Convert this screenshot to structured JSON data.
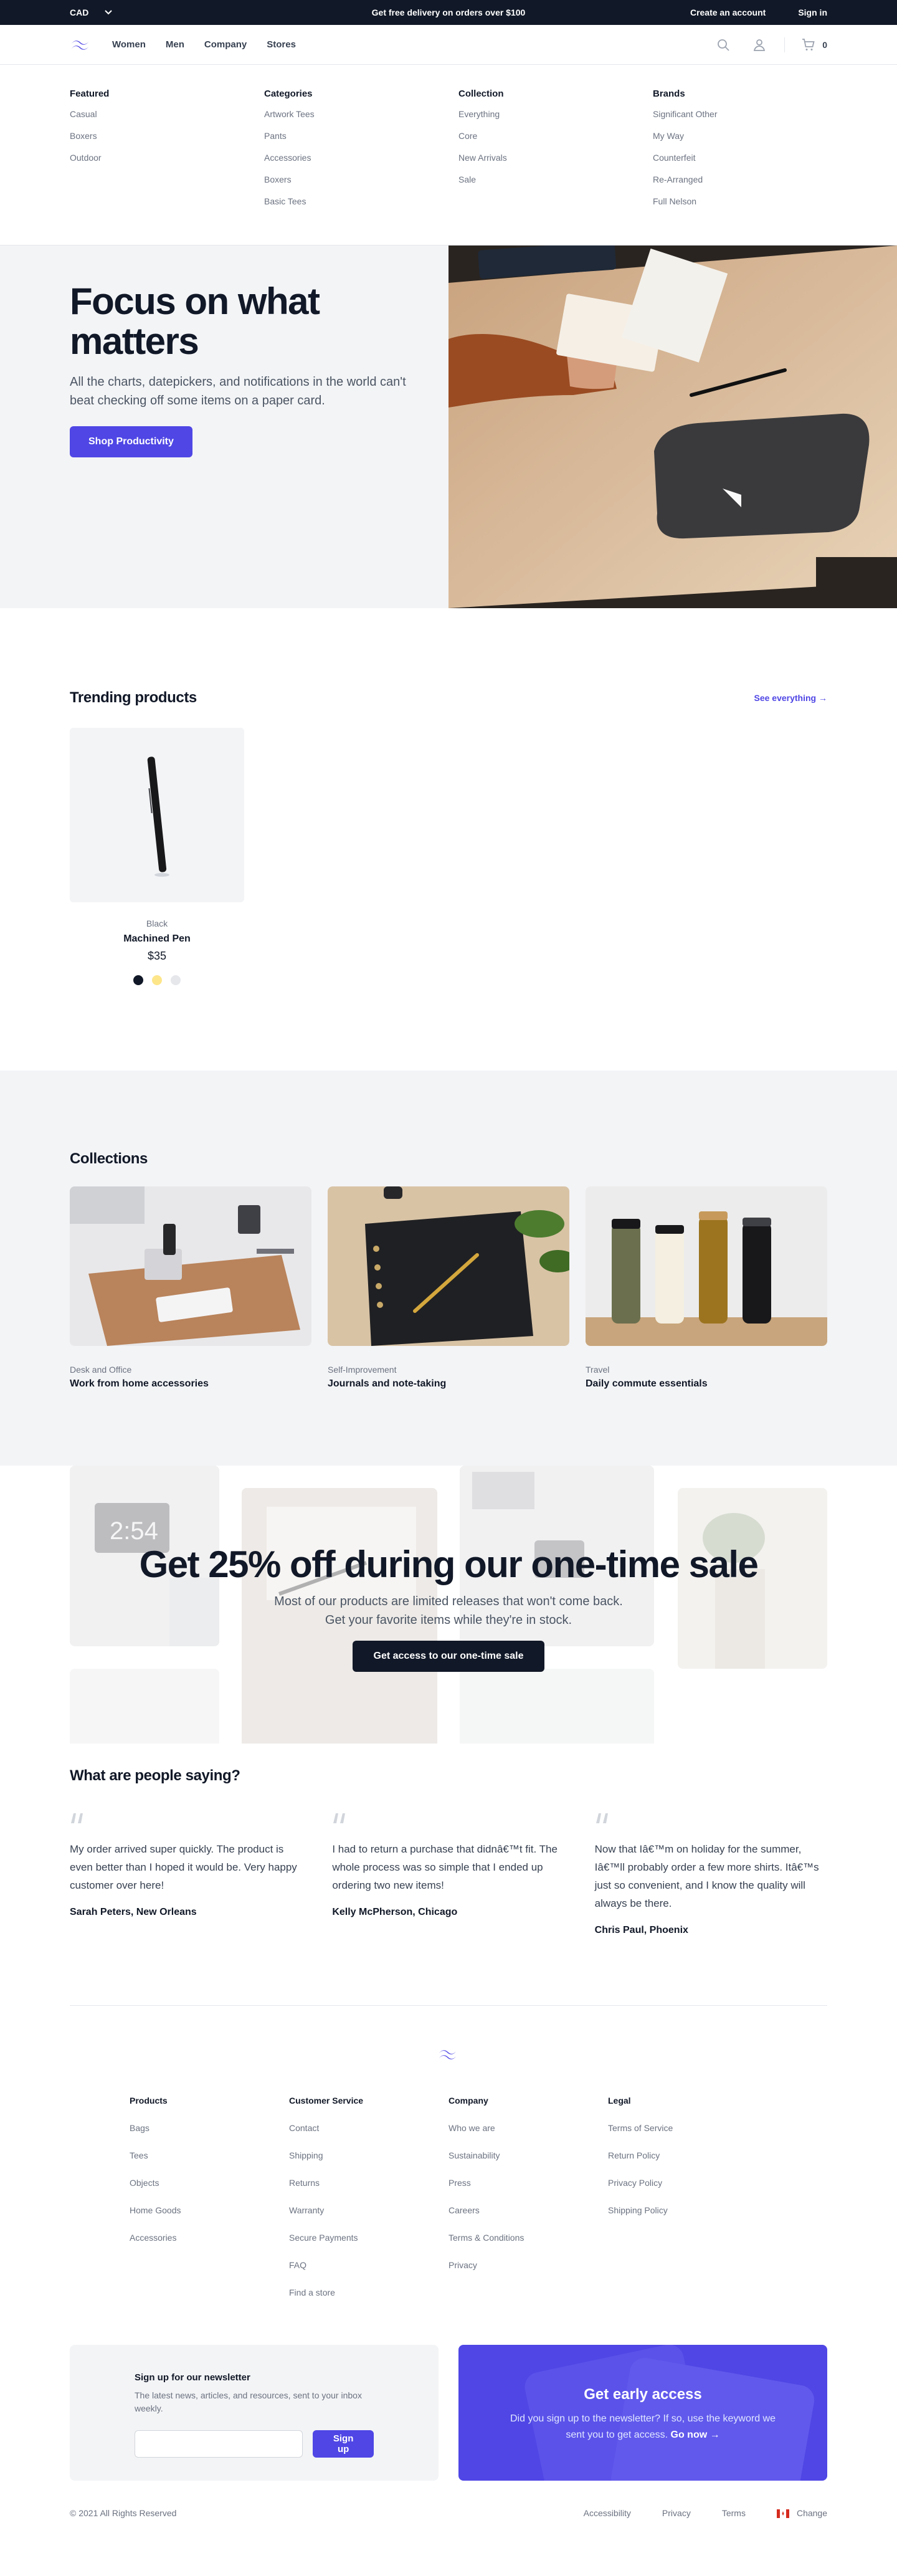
{
  "topbar": {
    "currency": "CAD",
    "promo": "Get free delivery on orders over $100",
    "create_account": "Create an account",
    "sign_in": "Sign in"
  },
  "nav": {
    "links": [
      "Women",
      "Men",
      "Company",
      "Stores"
    ],
    "cart_count": "0"
  },
  "mega": [
    {
      "title": "Featured",
      "items": [
        "Casual",
        "Boxers",
        "Outdoor"
      ]
    },
    {
      "title": "Categories",
      "items": [
        "Artwork Tees",
        "Pants",
        "Accessories",
        "Boxers",
        "Basic Tees"
      ]
    },
    {
      "title": "Collection",
      "items": [
        "Everything",
        "Core",
        "New Arrivals",
        "Sale"
      ]
    },
    {
      "title": "Brands",
      "items": [
        "Significant Other",
        "My Way",
        "Counterfeit",
        "Re-Arranged",
        "Full Nelson"
      ]
    }
  ],
  "hero": {
    "title": "Focus on what matters",
    "text": "All the charts, datepickers, and notifications in the world can't beat checking off some items on a paper card.",
    "cta": "Shop Productivity"
  },
  "trending": {
    "title": "Trending products",
    "see_all": "See everything →",
    "products": [
      {
        "color": "Black",
        "name": "Machined Pen",
        "price": "$35",
        "swatches": [
          "#111827",
          "#fde68a",
          "#e5e7eb"
        ]
      }
    ]
  },
  "collections": {
    "title": "Collections",
    "items": [
      {
        "category": "Desk and Office",
        "title": "Work from home accessories"
      },
      {
        "category": "Self-Improvement",
        "title": "Journals and note-taking"
      },
      {
        "category": "Travel",
        "title": "Daily commute essentials"
      }
    ]
  },
  "sale": {
    "title": "Get 25% off during our one-time sale",
    "line1": "Most of our products are limited releases that won't come back.",
    "line2": "Get your favorite items while they're in stock.",
    "cta": "Get access to our one-time sale"
  },
  "testimonials": {
    "title": "What are people saying?",
    "items": [
      {
        "quote": "My order arrived super quickly. The product is even better than I hoped it would be. Very happy customer over here!",
        "author": "Sarah Peters, New Orleans"
      },
      {
        "quote": "I had to return a purchase that didnâ€™t fit. The whole process was so simple that I ended up ordering two new items!",
        "author": "Kelly McPherson, Chicago"
      },
      {
        "quote": "Now that Iâ€™m on holiday for the summer, Iâ€™ll probably order a few more shirts. Itâ€™s just so convenient, and I know the quality will always be there.",
        "author": "Chris Paul, Phoenix"
      }
    ]
  },
  "footer": {
    "columns": [
      {
        "title": "Products",
        "items": [
          "Bags",
          "Tees",
          "Objects",
          "Home Goods",
          "Accessories"
        ]
      },
      {
        "title": "Customer Service",
        "items": [
          "Contact",
          "Shipping",
          "Returns",
          "Warranty",
          "Secure Payments",
          "FAQ",
          "Find a store"
        ]
      },
      {
        "title": "Company",
        "items": [
          "Who we are",
          "Sustainability",
          "Press",
          "Careers",
          "Terms & Conditions",
          "Privacy"
        ]
      },
      {
        "title": "Legal",
        "items": [
          "Terms of Service",
          "Return Policy",
          "Privacy Policy",
          "Shipping Policy"
        ]
      }
    ],
    "newsletter": {
      "title": "Sign up for our newsletter",
      "text": "The latest news, articles, and resources, sent to your inbox weekly.",
      "button": "Sign up",
      "placeholder": ""
    },
    "early": {
      "title": "Get early access",
      "text": "Did you sign up to the newsletter? If so, use the keyword we sent you to get access.",
      "link": "Go now →"
    },
    "copyright": "© 2021 All Rights Reserved",
    "links": [
      "Accessibility",
      "Privacy",
      "Terms"
    ],
    "change": "Change"
  },
  "colors": {
    "brand": "#4f46e5",
    "dark": "#111827",
    "gray_bg": "#f3f4f6"
  }
}
